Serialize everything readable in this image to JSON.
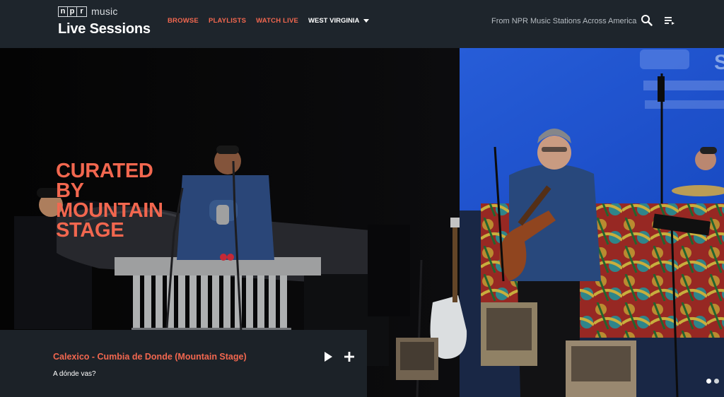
{
  "brand": {
    "logo_letters": [
      "n",
      "p",
      "r"
    ],
    "logo_suffix": "music",
    "site_title": "Live Sessions"
  },
  "nav": {
    "browse": "BROWSE",
    "playlists": "PLAYLISTS",
    "watch_live": "WATCH LIVE",
    "region": "WEST VIRGINIA"
  },
  "header": {
    "tagline": "From NPR Music Stations Across America",
    "search_icon": "search-icon",
    "queue_icon": "playlist-queue-icon"
  },
  "hero": {
    "heading_lines": [
      "CURATED",
      "BY",
      "MOUNTAIN",
      "STAGE"
    ],
    "banner_letter": "S"
  },
  "player": {
    "title": "Calexico - Cumbia de Donde (Mountain Stage)",
    "subtitle": "A dónde vas?",
    "play_icon": "play-icon",
    "add_icon": "add-icon"
  },
  "carousel": {
    "slides": 2,
    "active": 0
  },
  "colors": {
    "accent": "#f2674f",
    "header_bg": "#1e252c",
    "stage_blue": "#1f57d8"
  }
}
